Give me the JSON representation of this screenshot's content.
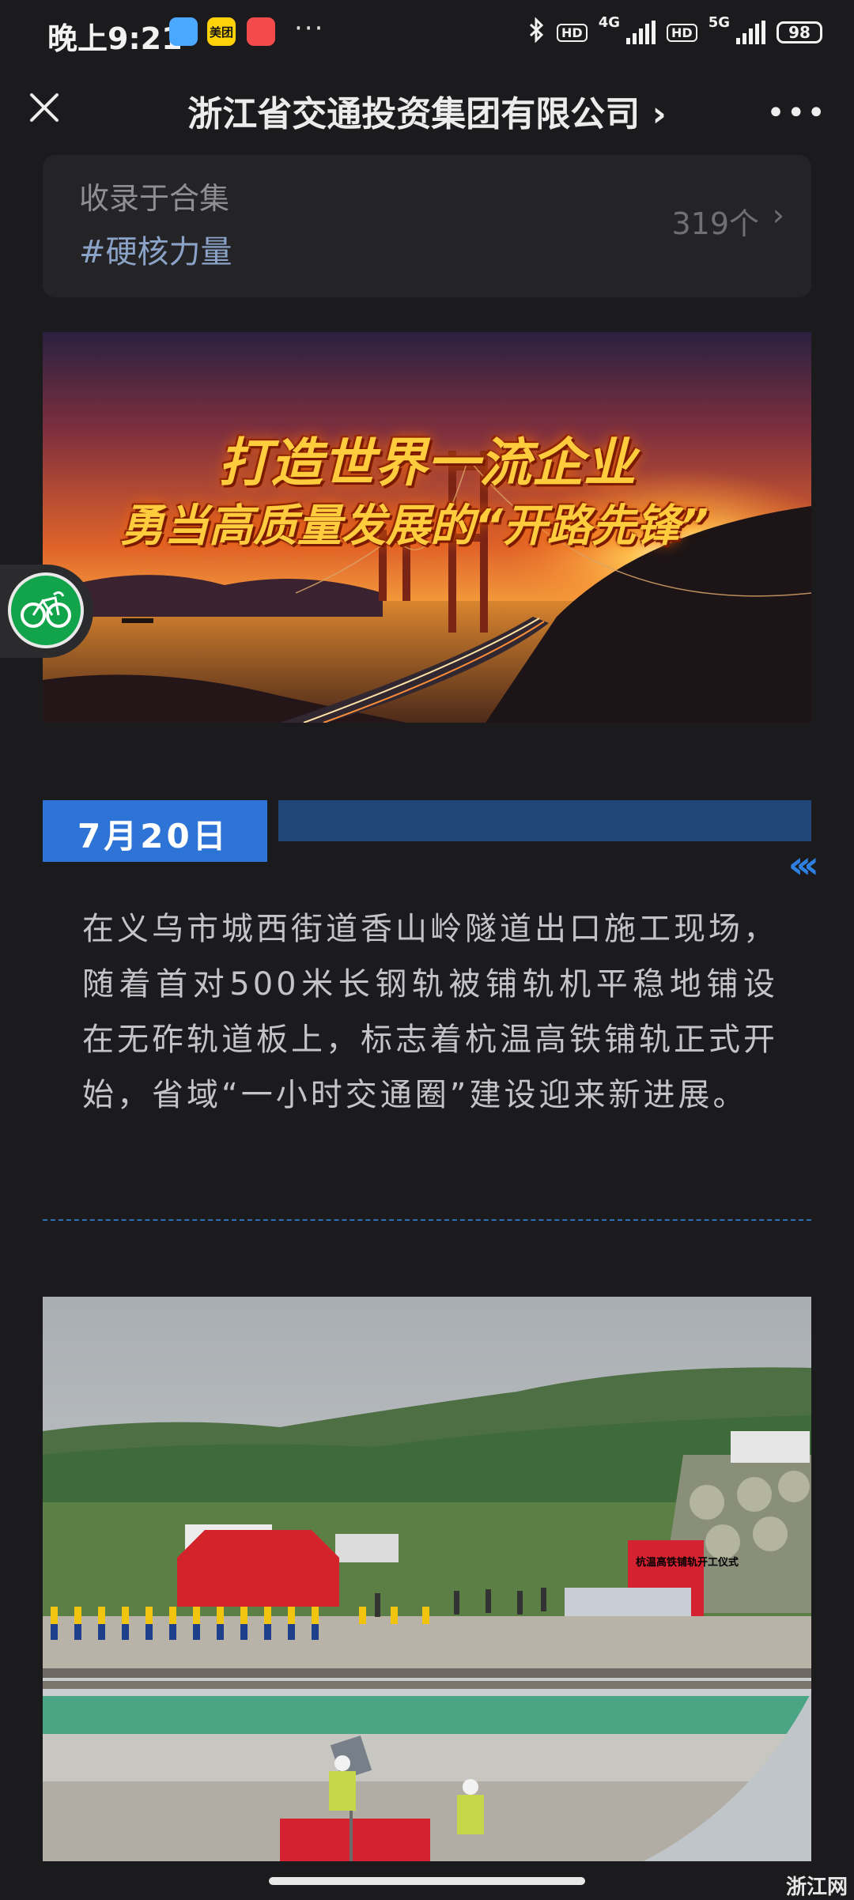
{
  "status_bar": {
    "time": "晚上9:21",
    "badges": [
      "",
      "美团",
      ""
    ],
    "more": "···",
    "hd1": "HD",
    "net1": "4G",
    "hd2": "HD",
    "net2": "5G",
    "battery": "98"
  },
  "nav": {
    "title": "浙江省交通投资集团有限公司 ›",
    "more": "•••"
  },
  "collection": {
    "label": "收录于合集",
    "tag": "#硬核力量",
    "count": "319个",
    "chevron": "›"
  },
  "banner": {
    "line1": "打造世界一流企业",
    "line2": "勇当高质量发展的“开路先锋”"
  },
  "section": {
    "date": "7月20日",
    "arrows": "‹‹‹"
  },
  "article": {
    "text": "在义乌市城西街道香山岭隧道出口施工现场，随着首对500米长钢轨被铺轨机平稳地铺设在无砟轨道板上，标志着杭温高铁铺轨正式开始，省域“一小时交通圈”建设迎来新进展。"
  },
  "photo": {
    "sign": "杭温高铁铺轨开工仪式"
  },
  "watermark": "浙江网",
  "colors": {
    "accent": "#2d74d6",
    "tag": "#8ba3c9",
    "float_button": "#11a44b"
  }
}
